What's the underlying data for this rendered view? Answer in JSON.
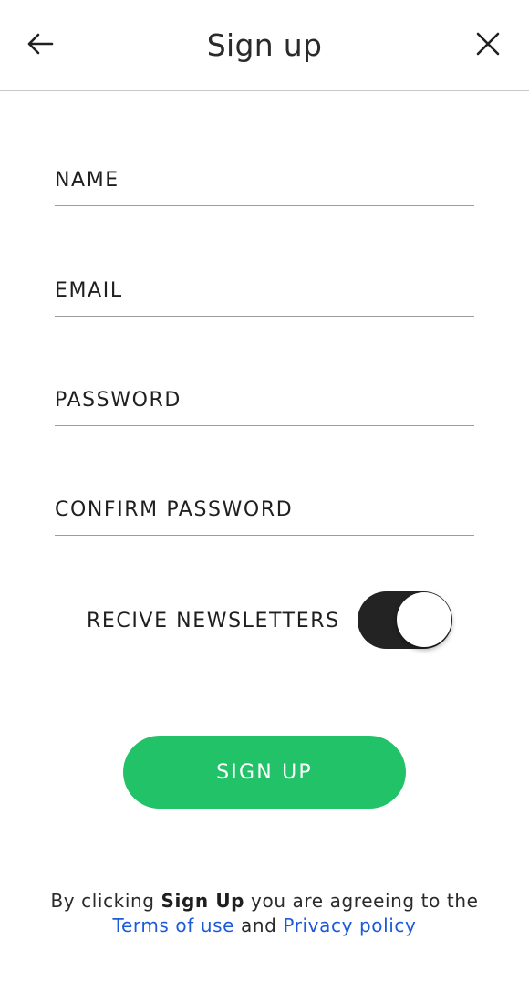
{
  "header": {
    "title": "Sign up",
    "back_icon": "arrow-left-icon",
    "close_icon": "close-icon"
  },
  "form": {
    "name_label": "NAME",
    "email_label": "EMAIL",
    "password_label": "PASSWORD",
    "confirm_password_label": "CONFIRM PASSWORD",
    "name_value": "",
    "email_value": "",
    "password_value": "",
    "confirm_password_value": ""
  },
  "newsletter": {
    "label": "RECIVE NEWSLETTERS",
    "enabled": true
  },
  "signup_button": {
    "label": "SIGN UP"
  },
  "legal": {
    "prefix": "By clicking ",
    "bold": "Sign Up",
    "middle": " you are agreeing to the",
    "terms_link": "Terms of use",
    "and": " and ",
    "privacy_link": "Privacy policy"
  },
  "colors": {
    "accent_green": "#22c268",
    "link_blue": "#1d5ad8",
    "toggle_track": "#232323"
  }
}
